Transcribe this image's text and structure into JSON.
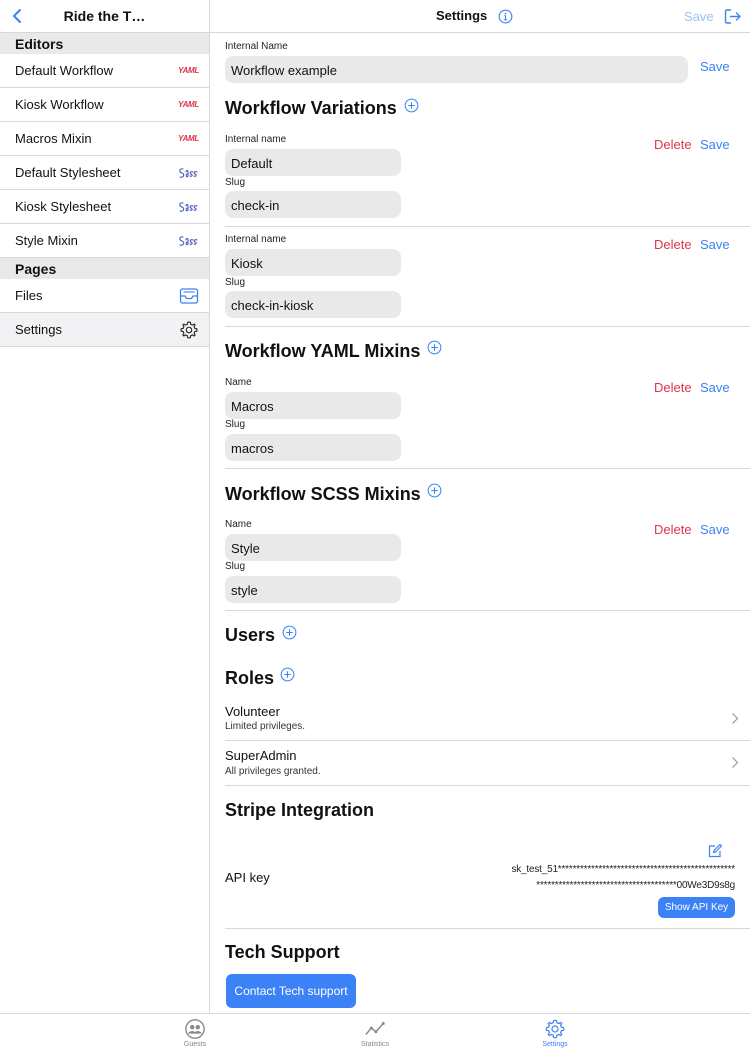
{
  "sidebar": {
    "title": "Ride the T…",
    "editors_header": "Editors",
    "editors": [
      {
        "label": "Default Workflow",
        "icon": "yaml-icon",
        "badge": "YAML"
      },
      {
        "label": "Kiosk Workflow",
        "icon": "yaml-icon",
        "badge": "YAML"
      },
      {
        "label": "Macros Mixin",
        "icon": "yaml-icon",
        "badge": "YAML"
      },
      {
        "label": "Default Stylesheet",
        "icon": "sass-icon"
      },
      {
        "label": "Kiosk Stylesheet",
        "icon": "sass-icon"
      },
      {
        "label": "Style Mixin",
        "icon": "sass-icon"
      }
    ],
    "pages_header": "Pages",
    "pages": [
      {
        "label": "Files",
        "icon": "inbox-icon"
      },
      {
        "label": "Settings",
        "icon": "gear-icon",
        "selected": true
      }
    ]
  },
  "header": {
    "title": "Settings",
    "save_label": "Save"
  },
  "workflow": {
    "internal_name_label": "Internal Name",
    "internal_name_value": "Workflow example",
    "save_label": "Save"
  },
  "variations": {
    "title": "Workflow Variations",
    "items": [
      {
        "name_label": "Internal name",
        "name": "Default",
        "slug_label": "Slug",
        "slug": "check-in",
        "delete": "Delete",
        "save": "Save"
      },
      {
        "name_label": "Internal name",
        "name": "Kiosk",
        "slug_label": "Slug",
        "slug": "check-in-kiosk",
        "delete": "Delete",
        "save": "Save"
      }
    ]
  },
  "yaml_mixins": {
    "title": "Workflow YAML Mixins",
    "items": [
      {
        "name_label": "Name",
        "name": "Macros",
        "slug_label": "Slug",
        "slug": "macros",
        "delete": "Delete",
        "save": "Save"
      }
    ]
  },
  "scss_mixins": {
    "title": "Workflow SCSS Mixins",
    "items": [
      {
        "name_label": "Name",
        "name": "Style",
        "slug_label": "Slug",
        "slug": "style",
        "delete": "Delete",
        "save": "Save"
      }
    ]
  },
  "users": {
    "title": "Users"
  },
  "roles": {
    "title": "Roles",
    "items": [
      {
        "name": "Volunteer",
        "description": "Limited privileges."
      },
      {
        "name": "SuperAdmin",
        "description": "All privileges granted."
      }
    ]
  },
  "stripe": {
    "title": "Stripe Integration",
    "api_key_label": "API key",
    "api_key_line1": "sk_test_51************************************************",
    "api_key_line2": "**************************************00We3D9s8g",
    "show_key_label": "Show API Key"
  },
  "support": {
    "title": "Tech Support",
    "button_label": "Contact Tech support"
  },
  "tabbar": {
    "tabs": [
      {
        "label": "Guests",
        "icon": "guests-icon"
      },
      {
        "label": "Statistics",
        "icon": "statistics-icon"
      },
      {
        "label": "Settings",
        "icon": "gear-icon",
        "active": true
      }
    ]
  },
  "colors": {
    "accent": "#3b82f6",
    "danger": "#e0344a",
    "disabled_save": "#9cc3ef",
    "field_bg": "#e9e9e9",
    "section_bg": "#e9e9ec"
  }
}
